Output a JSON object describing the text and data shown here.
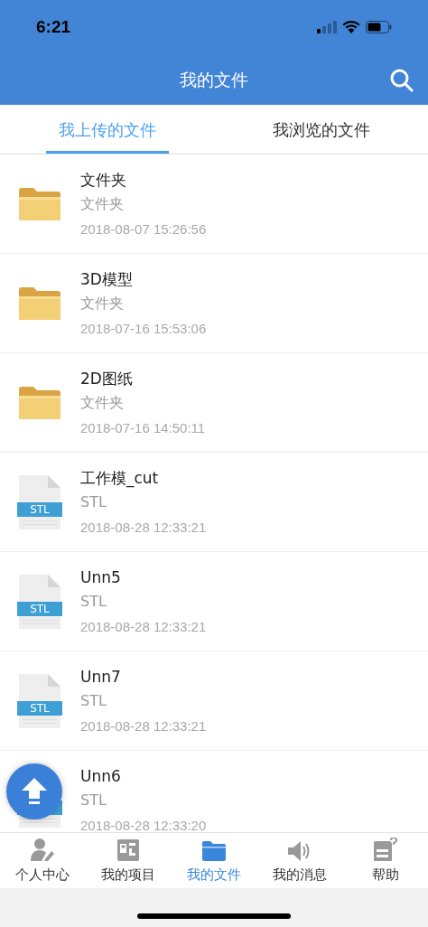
{
  "status_bar": {
    "time": "6:21"
  },
  "nav_bar": {
    "title": "我的文件"
  },
  "tabs": [
    {
      "label": "我上传的文件",
      "selected": true
    },
    {
      "label": "我浏览的文件",
      "selected": false
    }
  ],
  "files": [
    {
      "kind": "folder",
      "name": "文件夹",
      "type": "文件夹",
      "date": "2018-08-07 15:26:56"
    },
    {
      "kind": "folder",
      "name": "3D模型",
      "type": "文件夹",
      "date": "2018-07-16 15:53:06"
    },
    {
      "kind": "folder",
      "name": "2D图纸",
      "type": "文件夹",
      "date": "2018-07-16 14:50:11"
    },
    {
      "kind": "stl",
      "icon_label": "STL",
      "name": "工作模_cut",
      "type": "STL",
      "date": "2018-08-28 12:33:21"
    },
    {
      "kind": "stl",
      "icon_label": "STL",
      "name": "Unn5",
      "type": "STL",
      "date": "2018-08-28 12:33:21"
    },
    {
      "kind": "stl",
      "icon_label": "STL",
      "name": "Unn7",
      "type": "STL",
      "date": "2018-08-28 12:33:21"
    },
    {
      "kind": "stl",
      "name": "Unn6",
      "type": "STL",
      "date": "2018-08-28 12:33:20"
    }
  ],
  "tab_bar": [
    {
      "label": "个人中心",
      "selected": false
    },
    {
      "label": "我的项目",
      "selected": false
    },
    {
      "label": "我的文件",
      "selected": true
    },
    {
      "label": "我的消息",
      "selected": false
    },
    {
      "label": "帮助",
      "selected": false
    }
  ]
}
